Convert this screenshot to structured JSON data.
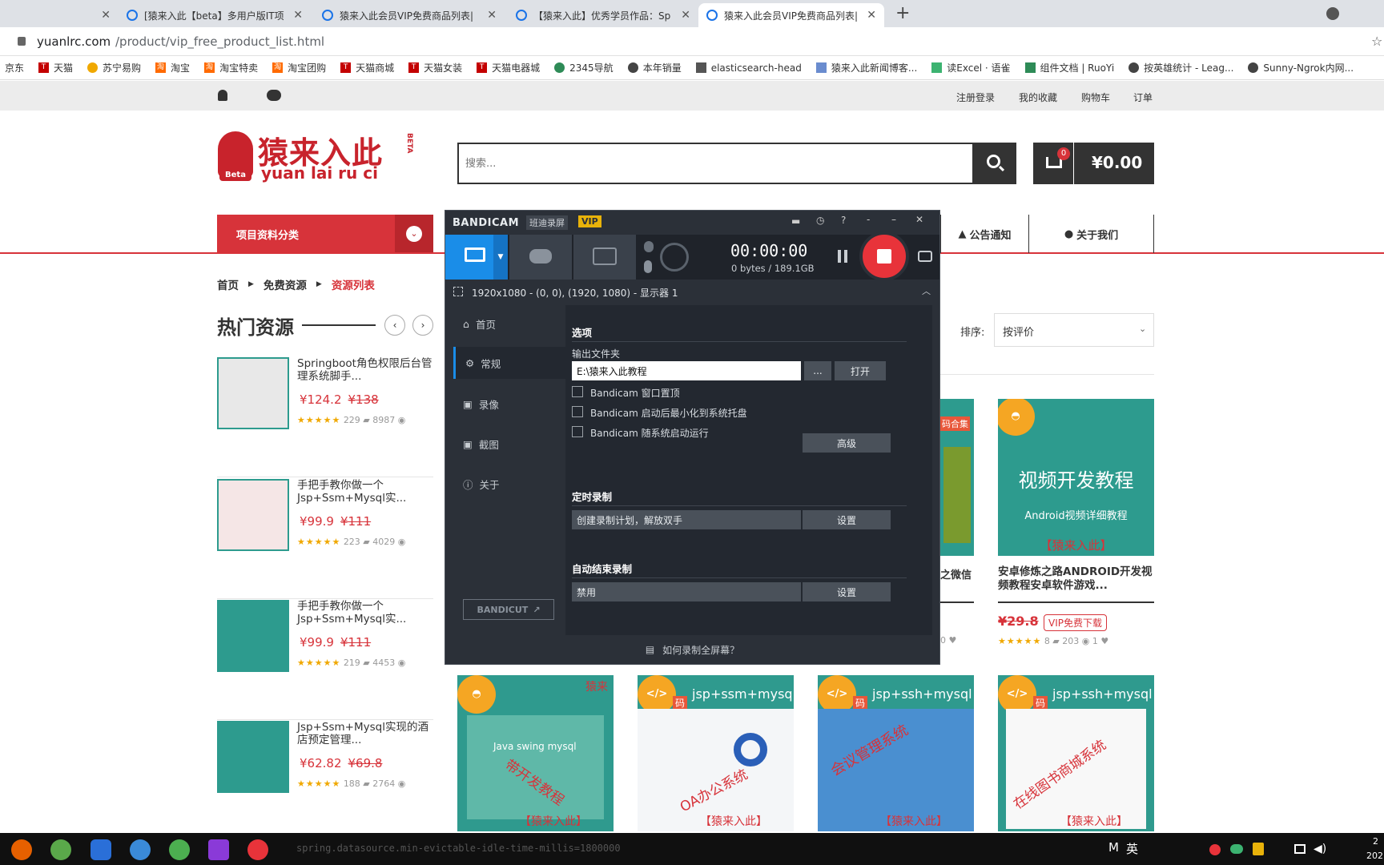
{
  "browser": {
    "tabs": [
      {
        "title": ""
      },
      {
        "title": "[猿来入此【beta】多用户版IT项"
      },
      {
        "title": "猿来入此会员VIP免费商品列表|"
      },
      {
        "title": "【猿来入此】优秀学员作品：Sp"
      },
      {
        "title": "猿来入此会员VIP免费商品列表|"
      }
    ],
    "new_tab": "+",
    "url_host": "yuanlrc.com",
    "url_path": "/product/vip_free_product_list.html",
    "bookmarks": [
      "京东",
      "天猫",
      "苏宁易购",
      "淘宝",
      "淘宝特卖",
      "淘宝团购",
      "天猫商城",
      "天猫女装",
      "天猫电器城",
      "2345导航",
      "本年销量",
      "elasticsearch-head",
      "猿来入此新闻博客...",
      "读Excel · 语雀",
      "组件文档 | RuoYi",
      "按英雄统计 - Leag...",
      "Sunny-Ngrok内网..."
    ]
  },
  "site": {
    "top_links": [
      "注册登录",
      "我的收藏",
      "购物车",
      "订单"
    ],
    "logo_cn": "猿来入此",
    "logo_en": "yuan lai ru ci",
    "logo_beta": "BETA",
    "logo_badge": "Beta",
    "search_placeholder": "搜索...",
    "cart_count": "0",
    "cart_total": "¥0.00",
    "category_label": "项目资料分类",
    "nav_items": [
      "公告通知",
      "关于我们"
    ],
    "breadcrumb": [
      "首页",
      "免费资源",
      "资源列表"
    ],
    "hot_title": "热门资源",
    "sort_label": "排序:",
    "sort_value": "按评价"
  },
  "sidebar_items": [
    {
      "title": "Springboot角色权限后台管理系统脚手...",
      "price": "¥124.2",
      "old": "¥138",
      "reviews": "229",
      "views": "8987"
    },
    {
      "title": "手把手教你做一个Jsp+Ssm+Mysql实...",
      "price": "¥99.9",
      "old": "¥111",
      "reviews": "223",
      "views": "4029"
    },
    {
      "title": "手把手教你做一个Jsp+Ssm+Mysql实...",
      "price": "¥99.9",
      "old": "¥111",
      "reviews": "219",
      "views": "4453"
    },
    {
      "title": "Jsp+Ssm+Mysql实现的酒店预定管理...",
      "price": "¥62.82",
      "old": "¥69.8",
      "reviews": "188",
      "views": "2764"
    }
  ],
  "featured": {
    "image_title": "视频开发教程",
    "image_sub": "Android视频详细教程",
    "image_brand": "【猿来入此】",
    "title": "安卓修炼之路ANDROID开发视频教程安卓软件游戏...",
    "price": "¥29.8",
    "vip": "VIP免费下载",
    "reviews": "8",
    "views": "203",
    "likes": "1"
  },
  "partial_product": {
    "label": "码合集",
    "title_tail": "之微信",
    "likes": "0"
  },
  "bottom_products": [
    {
      "tag": "Java swing mysql",
      "overlay": "带开发教程",
      "brand": "【猿来入此】",
      "corner": "猿来"
    },
    {
      "tag": "jsp+ssm+mysql",
      "overlay": "OA办公系统",
      "brand": "【猿来入此】",
      "corner": "码"
    },
    {
      "tag": "jsp+ssh+mysql",
      "overlay": "会议管理系统",
      "brand": "【猿来入此】",
      "corner": "码"
    },
    {
      "tag": "jsp+ssh+mysql",
      "overlay": "在线图书商城系统",
      "brand": "【猿来入此】",
      "corner": "码"
    }
  ],
  "bandicam": {
    "brand": "BANDICAM",
    "brand_cn": "班迪录屏",
    "vip": "VIP",
    "timer": "00:00:00",
    "size": "0 bytes / 189.1GB",
    "region": "1920x1080 - (0, 0), (1920, 1080) - 显示器 1",
    "menu": [
      "首页",
      "常规",
      "录像",
      "截图",
      "关于"
    ],
    "options_title": "选项",
    "output_label": "输出文件夹",
    "output_path": "E:\\猿来入此教程",
    "browse": "...",
    "open": "打开",
    "checkboxes": [
      "Bandicam 窗口置顶",
      "Bandicam 启动后最小化到系统托盘",
      "Bandicam 随系统启动运行"
    ],
    "advanced": "高级",
    "schedule_title": "定时录制",
    "schedule_text": "创建录制计划，解放双手",
    "schedule_btn": "设置",
    "autoend_title": "自动结束录制",
    "autoend_text": "禁用",
    "autoend_btn": "设置",
    "bandicut": "BANDICUT",
    "footer": "如何录制全屏幕？"
  },
  "taskbar": {
    "console_text": "spring.datasource.min-evictable-idle-time-millis=1800000",
    "tray": [
      "M",
      "英"
    ],
    "clock_a": "2",
    "clock_b": "202"
  },
  "colors": {
    "brand_red": "#d7333a",
    "teal": "#2d9b8e",
    "bandicam_blue": "#1a8de8"
  }
}
